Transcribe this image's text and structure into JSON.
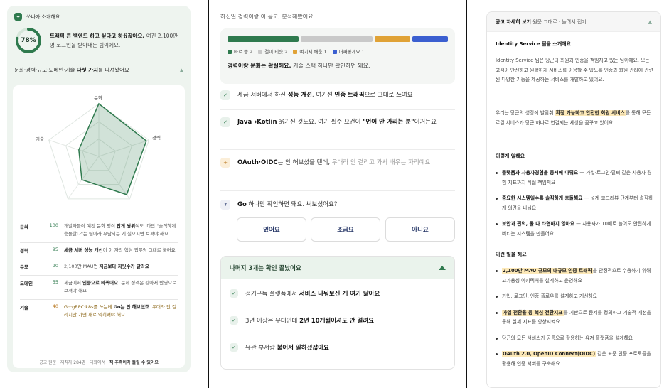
{
  "left": {
    "chip": "쏘나가 소개해요",
    "score": "78%",
    "score_value": 0.78,
    "score_bold": "트래픽 큰 백엔드 하고 싶다고 하셨잖아요.",
    "score_rest": "여긴 2,100만 명 로그인을 받아내는 팀이에요.",
    "section_title_prefix": "문화·경력·규모·도메인·기술 ",
    "section_title_bold": "다섯 가지",
    "section_title_suffix": "를 따져봤어요",
    "radar_labels": [
      "문화",
      "경력",
      "규모",
      "도메인",
      "기술"
    ],
    "radar_values": [
      1.0,
      0.95,
      0.9,
      0.55,
      0.4
    ],
    "rows": [
      {
        "k": "문화",
        "v": "100",
        "pre": "개발자들이 예전 문화 평이 ",
        "b": "압게 쌍위",
        "post": "여도. 다만 \"솔직하게 충돌한다\"는 팀이라 부담되는 게 실으시면 보셔야 해요",
        "warn": false
      },
      {
        "k": "경력",
        "v": "95",
        "pre": "",
        "b": "세금 서버 성능 개선",
        "post": "이 이 자리 핵심 업무랑 그대로 붙어요",
        "warn": false
      },
      {
        "k": "규모",
        "v": "90",
        "pre": "2,100만 MAU면 ",
        "b": "지금보다 자릿수가 달라요",
        "post": "",
        "warn": false
      },
      {
        "k": "도메인",
        "v": "55",
        "pre": "세금에서 ",
        "b": "인증으로 바뀌어요",
        "post": ". 문제 성격은 같아서 반영으로 보셔야 해요",
        "warn": false
      },
      {
        "k": "기술",
        "v": "40",
        "pre": "Go·gRPC·k8s를 쓰는데 ",
        "b": "Go는 안 해보셨죠",
        "post": ". 우대라 안 걸리지만 가면 새로 익히셔야 해요",
        "warn": true
      }
    ],
    "footnote_pre": "공고 원문 · 재직자 284명 · 대화에서 · ",
    "footnote_bold": "잭 추측이라 틀릴 수 있어요"
  },
  "middle": {
    "title": "하신일 경력이랑 이 공고, 분석해봤어요",
    "bar": [
      {
        "label": "바로 씀 2",
        "value": 2,
        "color": "#2f7a4e"
      },
      {
        "label": "결이 비슷 2",
        "value": 2,
        "color": "#c9c9c9"
      },
      {
        "label": "여기서 배움 1",
        "value": 1,
        "color": "#e0a236"
      },
      {
        "label": "어쩌볼게요 1",
        "value": 1,
        "color": "#3b5fd0"
      }
    ],
    "summary_bold": "경력이랑 문화는 확실해요.",
    "summary_rest": " 기술 스택 하나만 확인하면 돼요.",
    "q1_pre": "세금 서버에서 하신 ",
    "q1_b1": "성능 개선",
    "q1_mid": ", 여기선 ",
    "q1_b2": "인증 트래픽",
    "q1_post": "으로 그대로 쓰여요",
    "q2_b1": "Java→Kotlin",
    "q2_mid": " 옮기신 것도요. 여기 필수 요건이 ",
    "q2_b2": "\"언어 안 가리는 분\"",
    "q2_post": "이거든요",
    "q3_b1": "OAuth·OIDC",
    "q3_mid": "는 안 해보셨을 텐데, ",
    "q3_dim": "우대라 안 걸리고 가서 배우는 자리예요",
    "q4_b1": "Go",
    "q4_rest": " 하나만 확인하면 돼요. 써보셨어요?",
    "answers": [
      "있어요",
      "조금요",
      "아니요"
    ],
    "rest_title": "나머지 3개는 확인 끝났어요",
    "rest_items": [
      {
        "pre": "정기구독 플랫폼에서 ",
        "b": "서비스 나눠보신 게 여기 닮아요"
      },
      {
        "pre": "3년 이상은 우대인데 ",
        "b": "2년 10개월이셔도 안 걸려요"
      },
      {
        "pre": "유관 부서랑 ",
        "b": "붙어서 일하셨잖아요"
      }
    ]
  },
  "right": {
    "header_bold": "공고 자세히 보기",
    "header_rest": "원문 그대로 · 늘려서 접기",
    "h1": "Identity Service 팀을 소개해요",
    "p1": "Identity Service 팀은 당근의 회원과 인증을 책임지고 있는 팀이에요. 모든 고객이 안전하고 원활하게 서비스를 이용할 수 있도록 인증과 회원 관리에 관련된 다양한 기능을 제공하는 서비스를 개발하고 있어요.",
    "p2_pre": "우리는 당근의 성장에 발맞춰 ",
    "p2_hl": "확장 가능하고 안전한 회원 서비스",
    "p2_post": "를 통해 모든 로컬 서비스가 당근 하나로 연결되는 세상을 꿈꾸고 있어요.",
    "h2": "이렇게 일해요",
    "work": [
      {
        "b": "플랫폼과 사용자경험을 동시에 다뤄요",
        "rest": " — 가입·로그인·탈퇴 같은 사용자 경험 지표까지 직접 책임져요"
      },
      {
        "b": "중요한 시스템일수록 솔직하게 충돌해요",
        "rest": " — 설계·코드리뷰 단계부터 솔직하게 의견을 나눠요"
      },
      {
        "b": "보안과 편의, 둘 다 타협하지 않아요",
        "rest": " — 사용자가 10배로 늘어도 안전하게 버티는 시스템을 만들어요"
      }
    ],
    "h3": "이런 일을 해요",
    "tasks": [
      {
        "pre": "",
        "hl": "2,100만 MAU 규모의 대규모 인증 트래픽",
        "post": "을 안정적으로 수용하기 위해 고가용성 아키텍처를 설계하고 운영해요"
      },
      {
        "pre": "가입, 로그인, 인증 플로우를 설계하고 개선해요",
        "hl": "",
        "post": ""
      },
      {
        "pre": "",
        "hl": "가입 전환율 등 핵심 전환지표",
        "post": "를 기반으로 문제를 정의하고 기술적 개선을 통해 실제 지표를 향상시켜요"
      },
      {
        "pre": "당근의 모든 서비스가 공통으로 활용하는 유저 플랫폼을 설계해요",
        "hl": "",
        "post": ""
      },
      {
        "pre": "",
        "hl": "OAuth 2.0, OpenID Connect(OIDC)",
        "post": " 같은 표준 인증 프로토콜을 활용해 인증 서버를 구축해요"
      }
    ]
  }
}
